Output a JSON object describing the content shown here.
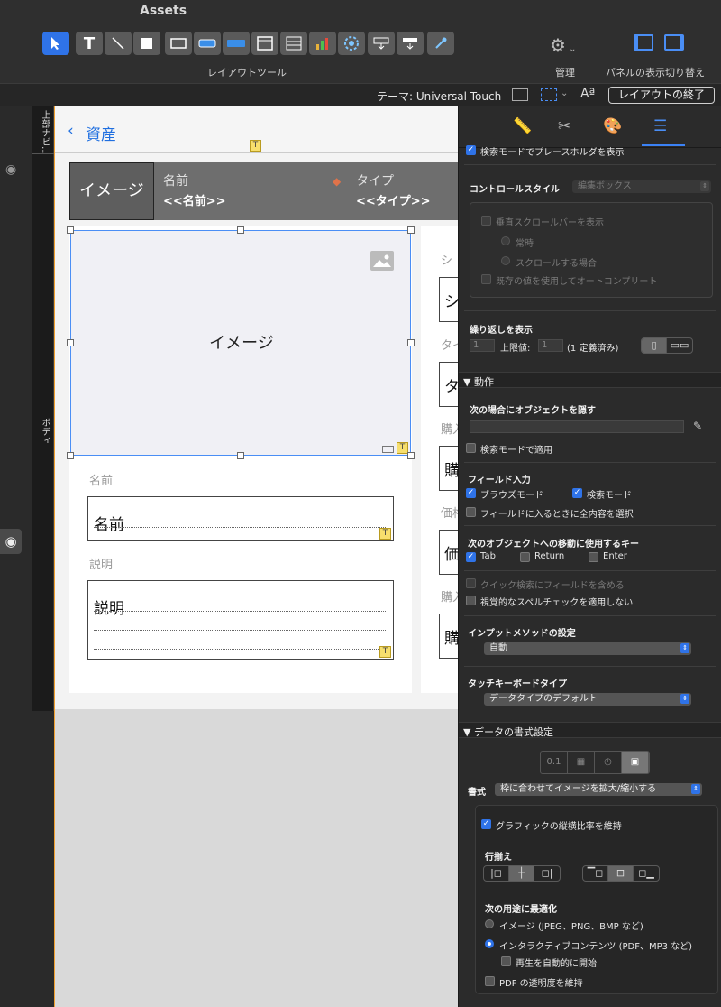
{
  "app": {
    "title": "Assets"
  },
  "toolbar": {
    "layout_tools_label": "レイアウトツール",
    "manage_label": "管理",
    "panel_toggle_label": "パネルの表示切り替え"
  },
  "themebar": {
    "theme_label": "テーマ: Universal Touch",
    "exit_layout_label": "レイアウトの終了"
  },
  "gutter": {
    "top_part_label": "上部ナビ…",
    "body_part_label": "ボディ"
  },
  "canvas": {
    "back_title": "資産",
    "badge_t": "T",
    "list_header": {
      "image_label": "イメージ",
      "name_label": "名前",
      "name_value": "<<名前>>",
      "type_label": "タイプ",
      "type_value": "<<タイプ>>"
    },
    "image_container_label": "イメージ",
    "name_field_label": "名前",
    "name_field_value": "名前",
    "desc_field_label": "説明",
    "desc_field_value": "説明",
    "right_column": [
      {
        "label": "シ",
        "value": "シ"
      },
      {
        "label": "タイ",
        "value": "タ"
      },
      {
        "label": "購入",
        "value": "購"
      },
      {
        "label": "価格",
        "value": "価"
      },
      {
        "label": "購入",
        "value": "購"
      }
    ]
  },
  "inspector": {
    "top_cut_label": "検索モードでプレースホルダを表示",
    "control_style_label": "コントロールスタイル",
    "control_style_value": "編集ボックス",
    "show_vscroll": "垂直スクロールバーを表示",
    "always": "常時",
    "when_scrolling": "スクロールする場合",
    "autocomplete": "既存の値を使用してオートコンプリート",
    "repeat_label": "繰り返しを表示",
    "repeat_from": "1",
    "max_label": "上限値:",
    "repeat_to": "1",
    "defined_label": "(1 定義済み)",
    "behavior_header": "▼ 動作",
    "hide_object_label": "次の場合にオブジェクトを隠す",
    "apply_in_find": "検索モードで適用",
    "field_entry_label": "フィールド入力",
    "browse_mode": "ブラウズモード",
    "find_mode": "検索モード",
    "select_all_on_entry": "フィールドに入るときに全内容を選択",
    "next_object_keys_label": "次のオブジェクトへの移動に使用するキー",
    "key_tab": "Tab",
    "key_return": "Return",
    "key_enter": "Enter",
    "include_quick_find": "クイック検索にフィールドを含める",
    "no_spellcheck": "視覚的なスペルチェックを適用しない",
    "input_method_label": "インプットメソッドの設定",
    "input_method_value": "自動",
    "touch_kb_label": "タッチキーボードタイプ",
    "touch_kb_value": "データタイプのデフォルト",
    "data_format_header": "▼ データの書式設定",
    "format_tab_number": "0.1",
    "format_label": "書式",
    "format_value": "枠に合わせてイメージを拡大/縮小する",
    "keep_aspect": "グラフィックの縦横比率を維持",
    "alignment_label": "行揃え",
    "optimize_label": "次の用途に最適化",
    "opt_images": "イメージ (JPEG、PNG、BMP など)",
    "opt_interactive": "インタラクティブコンテンツ (PDF、MP3 など)",
    "auto_play": "再生を自動的に開始",
    "pdf_transparency": "PDF の透明度を維持"
  }
}
